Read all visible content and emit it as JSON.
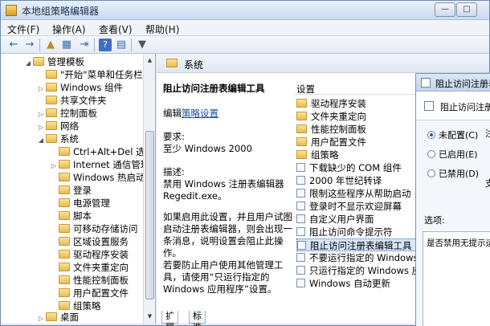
{
  "window": {
    "title": "本地组策略编辑器",
    "buttons": [
      "—",
      "□",
      "✕"
    ]
  },
  "menu": [
    "文件(F)",
    "操作(A)",
    "查看(V)",
    "帮助(H)"
  ],
  "toolbar": [
    "←",
    "→",
    "▲",
    "▦",
    "⇥",
    "?",
    "▤",
    "▼"
  ],
  "tree": [
    {
      "label": "管理模板",
      "indent": 0
    },
    {
      "label": "\"开始\"菜单和任务栏",
      "indent": 1
    },
    {
      "label": "Windows 组件",
      "indent": 1
    },
    {
      "label": "共享文件夹",
      "indent": 1
    },
    {
      "label": "控制面板",
      "indent": 1
    },
    {
      "label": "网络",
      "indent": 1
    },
    {
      "label": "系统",
      "indent": 1
    },
    {
      "label": "Ctrl+Alt+Del 选项",
      "indent": 2
    },
    {
      "label": "Internet 通信管理",
      "indent": 2
    },
    {
      "label": "Windows 热启动",
      "indent": 2
    },
    {
      "label": "登录",
      "indent": 2
    },
    {
      "label": "电源管理",
      "indent": 2
    },
    {
      "label": "脚本",
      "indent": 2
    },
    {
      "label": "可移动存储访问",
      "indent": 2
    },
    {
      "label": "区域设置服务",
      "indent": 2
    },
    {
      "label": "驱动程序安装",
      "indent": 2
    },
    {
      "label": "文件夹重定向",
      "indent": 2
    },
    {
      "label": "性能控制面板",
      "indent": 2
    },
    {
      "label": "用户配置文件",
      "indent": 2
    },
    {
      "label": "组策略",
      "indent": 2
    },
    {
      "label": "桌面",
      "indent": 1
    }
  ],
  "breadcrumb": "系统",
  "description": {
    "title": "阻止访问注册表编辑工具",
    "edit_prefix": "编辑",
    "edit_link": "策略设置",
    "req_label": "要求:",
    "req_value": "至少 Windows 2000",
    "desc_label": "描述:",
    "desc_text": "禁用 Windows 注册表编辑器 Regedit.exe。",
    "para1": "如果启用此设置，并且用户试图启动注册表编辑器，则会出现一条消息，说明设置会阻止此操作。",
    "para2": "若要防止用户使用其他管理工具，请使用“只运行指定的 Windows 应用程序”设置。"
  },
  "settings_header": "设置",
  "settings": [
    {
      "label": "驱动程序安装",
      "type": "folder"
    },
    {
      "label": "文件夹重定向",
      "type": "folder"
    },
    {
      "label": "性能控制面板",
      "type": "folder"
    },
    {
      "label": "用户配置文件",
      "type": "folder"
    },
    {
      "label": "组策略",
      "type": "folder"
    },
    {
      "label": "下载缺少的 COM 组件",
      "type": "policy"
    },
    {
      "label": "2000 年世纪转译",
      "type": "policy"
    },
    {
      "label": "限制这些程序从帮助启动",
      "type": "policy"
    },
    {
      "label": "登录时不显示欢迎屏幕",
      "type": "policy"
    },
    {
      "label": "自定义用户界面",
      "type": "policy"
    },
    {
      "label": "阻止访问命令提示符",
      "type": "policy"
    },
    {
      "label": "阻止访问注册表编辑工具",
      "type": "policy"
    },
    {
      "label": "不要运行指定的 Windows 应用程",
      "type": "policy"
    },
    {
      "label": "只运行指定的 Windows 应用程",
      "type": "policy"
    },
    {
      "label": "Windows 自动更新",
      "type": "policy"
    }
  ],
  "tabs": [
    "扩展",
    "标准"
  ],
  "dialog": {
    "title": "阻止访问注册表",
    "subtitle": "阻止访问注册",
    "options": [
      "未配置(C)",
      "已启用(E)",
      "已禁用(D)"
    ],
    "selected": 0,
    "side_chars": [
      "注",
      "支"
    ],
    "options_label": "选项:",
    "box_text": "是否禁用无提示运"
  }
}
